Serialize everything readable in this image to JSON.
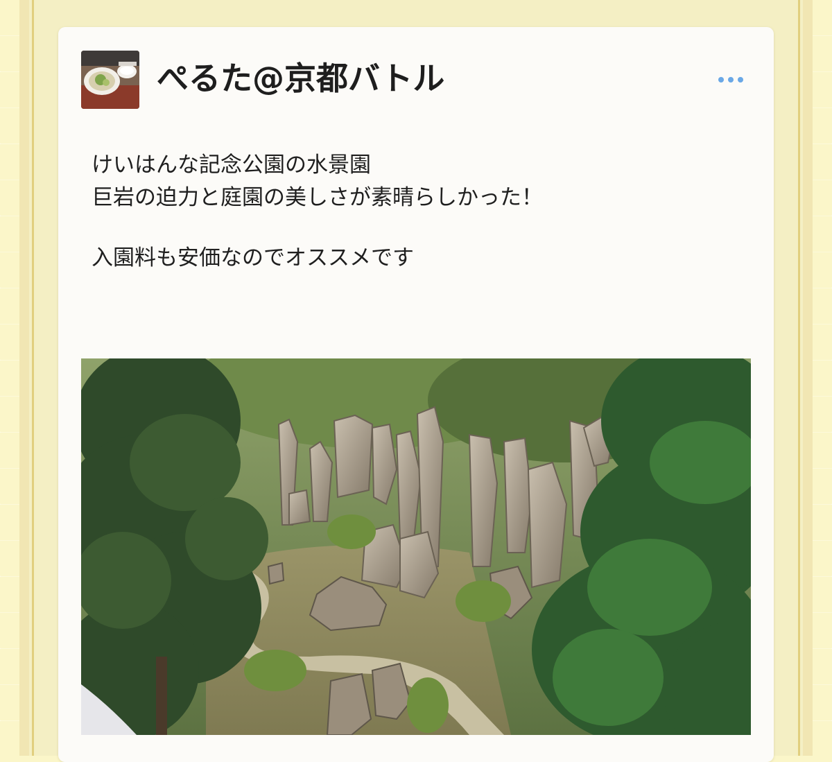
{
  "post": {
    "author": {
      "display_name": "ぺるた@京都バトル",
      "avatar_icon": "avatar-ramen-photo"
    },
    "menu_icon": "more-horizontal-icon",
    "text_lines": [
      "けいはんな記念公園の水景園",
      "巨岩の迫力と庭園の美しさが素晴らしかった！",
      "",
      "入園料も安価なのでオススメです"
    ],
    "image": {
      "icon": "garden-rocks-photo"
    }
  },
  "colors": {
    "background": "#fbf6c9",
    "card": "#fcfbf8",
    "accent_dots": "#6aa8e6",
    "text": "#1f1f1f"
  }
}
